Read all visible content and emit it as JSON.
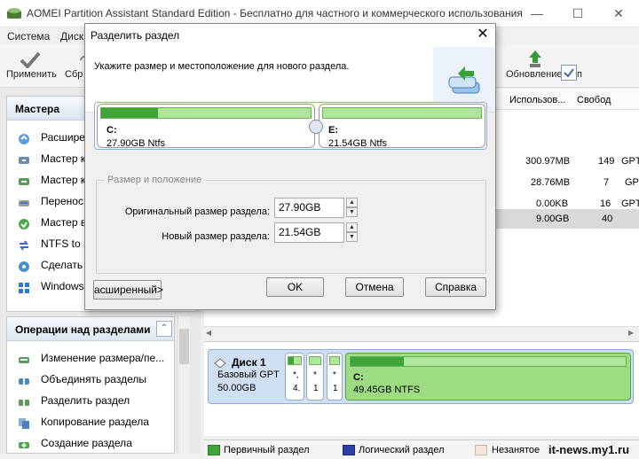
{
  "window": {
    "title": "AOMEI Partition Assistant Standard Edition - Бесплатно для частного и коммерческого использования"
  },
  "menu": [
    "Система",
    "Диск"
  ],
  "toolbar": {
    "apply": "Применить",
    "discard": "Сбр",
    "update": "Обновление",
    "update_suffix": "п"
  },
  "wizards_panel": {
    "title": "Мастера",
    "items": [
      "Расширен",
      "Мастер ко",
      "Мастер ко",
      "Перенос С",
      "Мастер во",
      "NTFS to FA",
      "Сделать з",
      "Windows T"
    ]
  },
  "operations_panel": {
    "title": "Операции над разделами",
    "items": [
      "Изменение размера/пе...",
      "Объединять разделы",
      "Разделить раздел",
      "Копирование раздела",
      "Создание раздела"
    ]
  },
  "grid": {
    "columns": [
      "Использов...",
      "Свобод"
    ],
    "rows": [
      {
        "used": "300.97MB",
        "free": "149",
        "fs": "GPT"
      },
      {
        "used": "28.76MB",
        "free": "7",
        "fs": "GPT"
      },
      {
        "used": "0.00KB",
        "free": "16",
        "fs": "GPT"
      },
      {
        "used": "9.00GB",
        "free": "40",
        "fs": ""
      }
    ]
  },
  "disk_map": {
    "disk_name": "Диск 1",
    "disk_type": "Базовый GPT",
    "disk_size": "50.00GB",
    "small_parts": [
      {
        "label": "*,",
        "size": "4."
      },
      {
        "label": "*",
        "size": "1"
      },
      {
        "label": "*",
        "size": "1"
      }
    ],
    "main_part": {
      "letter": "C:",
      "info": "49.45GB NTFS"
    }
  },
  "legend": {
    "primary": "Первичный раздел",
    "logical": "Логический раздел",
    "unallocated": "Незанятое"
  },
  "watermark": "it-news.my1.ru",
  "dialog": {
    "title": "Разделить раздел",
    "instruction": "Укажите размер и местоположение для нового раздела.",
    "part_left": {
      "letter": "C:",
      "info": "27.90GB Ntfs",
      "used_fraction": 0.27
    },
    "part_right": {
      "letter": "E:",
      "info": "21.54GB Ntfs",
      "used_fraction": 0.0
    },
    "group_title": "Размер и положение",
    "original_label": "Оригинальный размер раздела:",
    "original_value": "27.90GB",
    "new_label": "Новый размер раздела:",
    "new_value": "21.54GB",
    "advanced_btn": "асширенный>",
    "ok_btn": "OK",
    "cancel_btn": "Отмена",
    "help_btn": "Справка"
  },
  "colors": {
    "primary_partition": "#3fa43a",
    "selected_disk": "#cfe0f5",
    "logical_partition": "#2b3fa4"
  }
}
